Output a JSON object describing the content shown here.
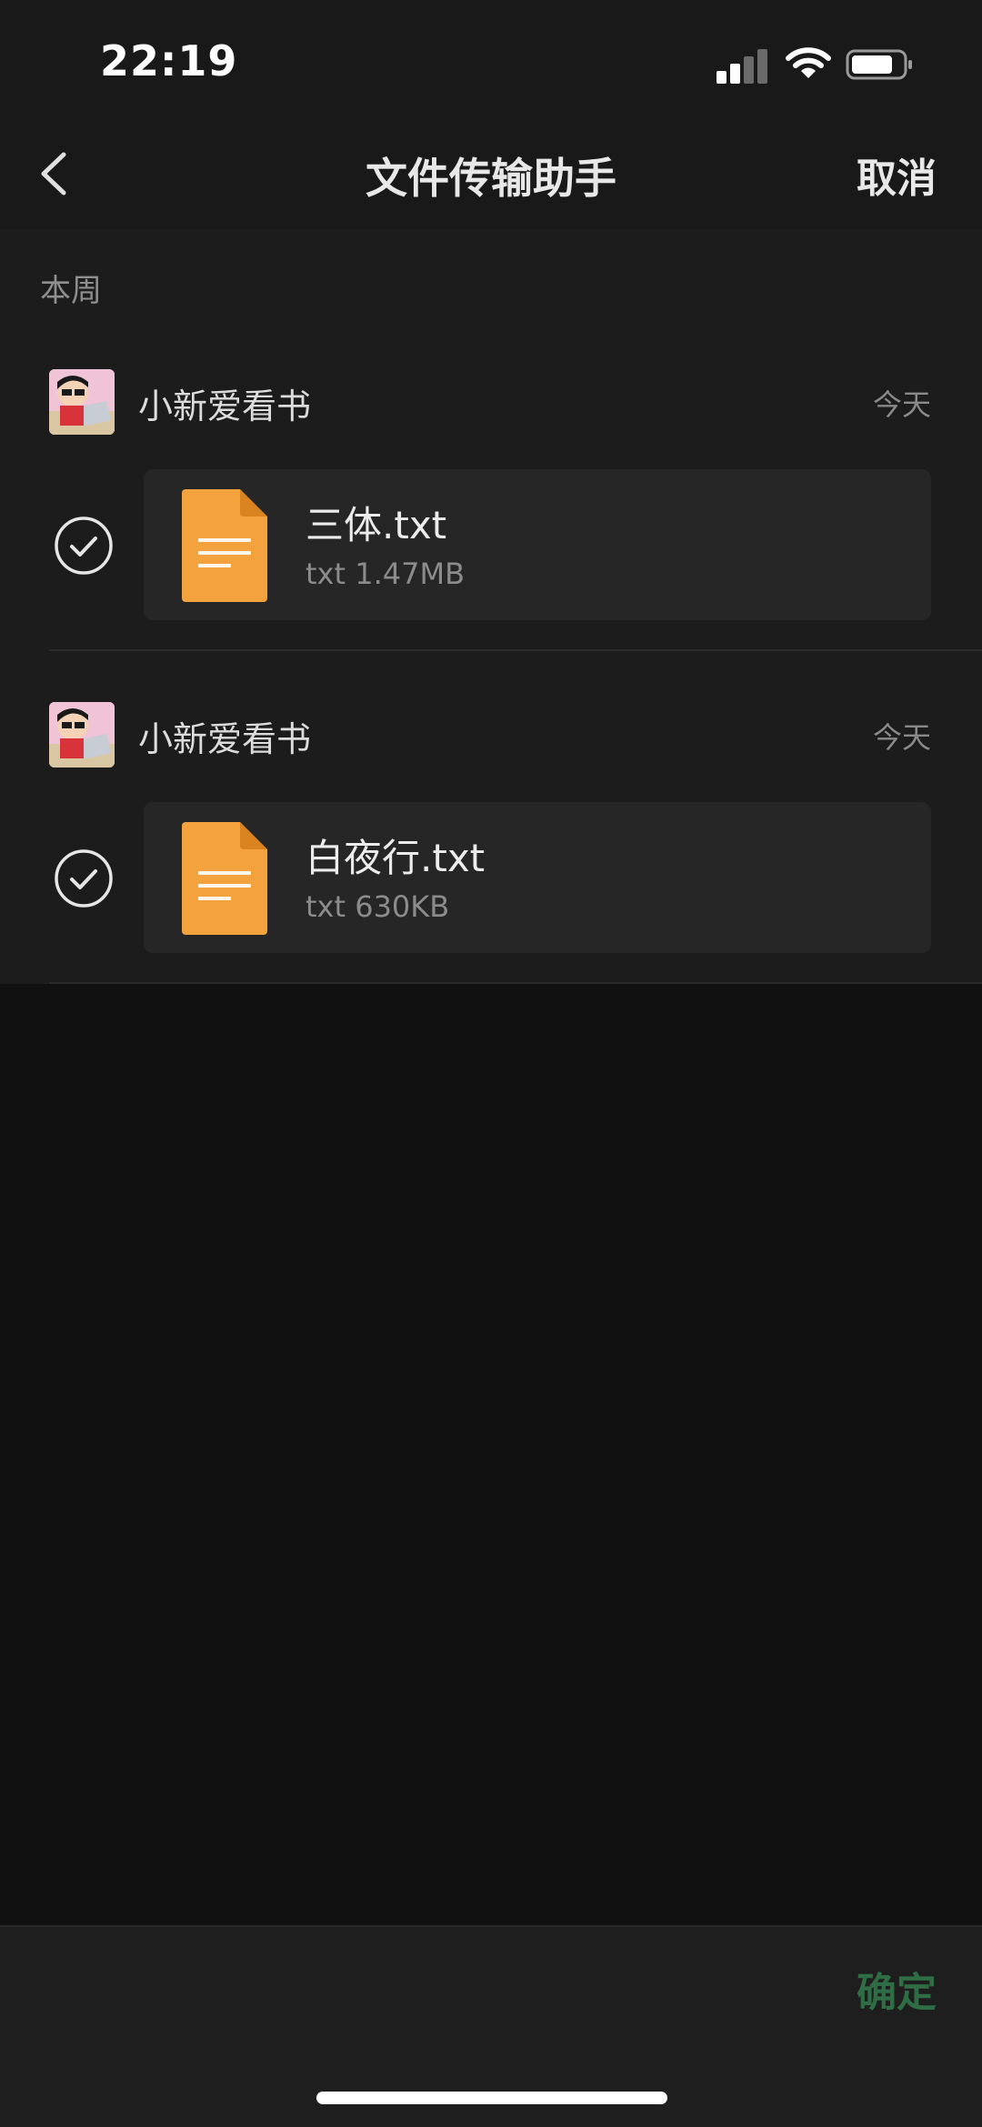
{
  "status_bar": {
    "time": "22:19",
    "icons": [
      "signal-icon",
      "wifi-icon",
      "battery-icon"
    ]
  },
  "nav": {
    "title": "文件传输助手",
    "back_icon": "chevron-left-icon",
    "cancel_label": "取消"
  },
  "section": {
    "header": "本周"
  },
  "messages": [
    {
      "sender": "小新爱看书",
      "date": "今天",
      "selected": true,
      "file": {
        "name": "三体.txt",
        "meta": "txt 1.47MB",
        "icon": "document-icon"
      }
    },
    {
      "sender": "小新爱看书",
      "date": "今天",
      "selected": true,
      "file": {
        "name": "白夜行.txt",
        "meta": "txt 630KB",
        "icon": "document-icon"
      }
    }
  ],
  "footer": {
    "confirm_label": "确定"
  },
  "colors": {
    "background": "#111111",
    "list_background": "#1c1c1c",
    "file_icon": "#f4a23d",
    "confirm_disabled": "#2f6d45"
  }
}
